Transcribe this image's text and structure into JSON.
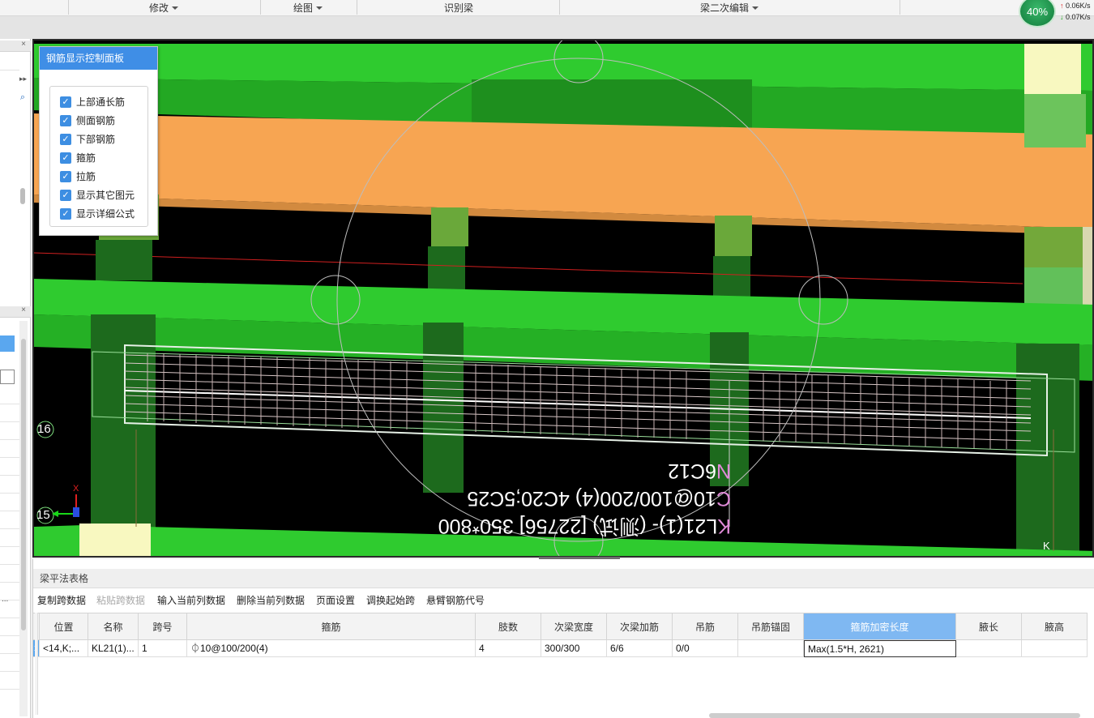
{
  "ribbon": {
    "modify_label": "修改",
    "draw_label": "绘图",
    "identify_label": "识别梁",
    "secondary_edit_label": "梁二次编辑"
  },
  "net": {
    "percent": "40%",
    "up": "0.06K/s",
    "down": "0.07K/s"
  },
  "control_panel": {
    "title": "钢筋显示控制面板",
    "items": [
      {
        "label": "上部通长筋",
        "checked": true
      },
      {
        "label": "侧面钢筋",
        "checked": true
      },
      {
        "label": "下部钢筋",
        "checked": true
      },
      {
        "label": "箍筋",
        "checked": true
      },
      {
        "label": "拉筋",
        "checked": true
      },
      {
        "label": "显示其它图元",
        "checked": true
      },
      {
        "label": "显示详细公式",
        "checked": true
      }
    ]
  },
  "viewport": {
    "axis_labels": [
      "16",
      "15",
      "K"
    ],
    "annotation_lines": [
      "KL21(1)- (测试) [22756] 350*800",
      "C10@100/200(4) 4C20;5C25",
      "N6C12"
    ],
    "annotation_prefix_color": "#e08ad8",
    "beam_green": "#2fcb2f",
    "column_orange": "#f7a552"
  },
  "table": {
    "panel_title": "梁平法表格",
    "toolbar": [
      "复制跨数据",
      "粘贴跨数据",
      "输入当前列数据",
      "删除当前列数据",
      "页面设置",
      "调换起始跨",
      "悬臂钢筋代号"
    ],
    "columns": [
      "位置",
      "名称",
      "跨号",
      "箍筋",
      "肢数",
      "次梁宽度",
      "次梁加筋",
      "吊筋",
      "吊筋锚固",
      "箍筋加密长度",
      "腋长",
      "腋高"
    ],
    "rows": [
      {
        "index": "1",
        "cells": [
          "<14,K;...",
          "KL21(1)...",
          "1",
          "⏀10@100/200(4)",
          "4",
          "300/300",
          "6/6",
          "0/0",
          "",
          "Max(1.5*H, 2621)",
          "",
          ""
        ]
      }
    ],
    "active_column": "箍筋加密长度"
  }
}
